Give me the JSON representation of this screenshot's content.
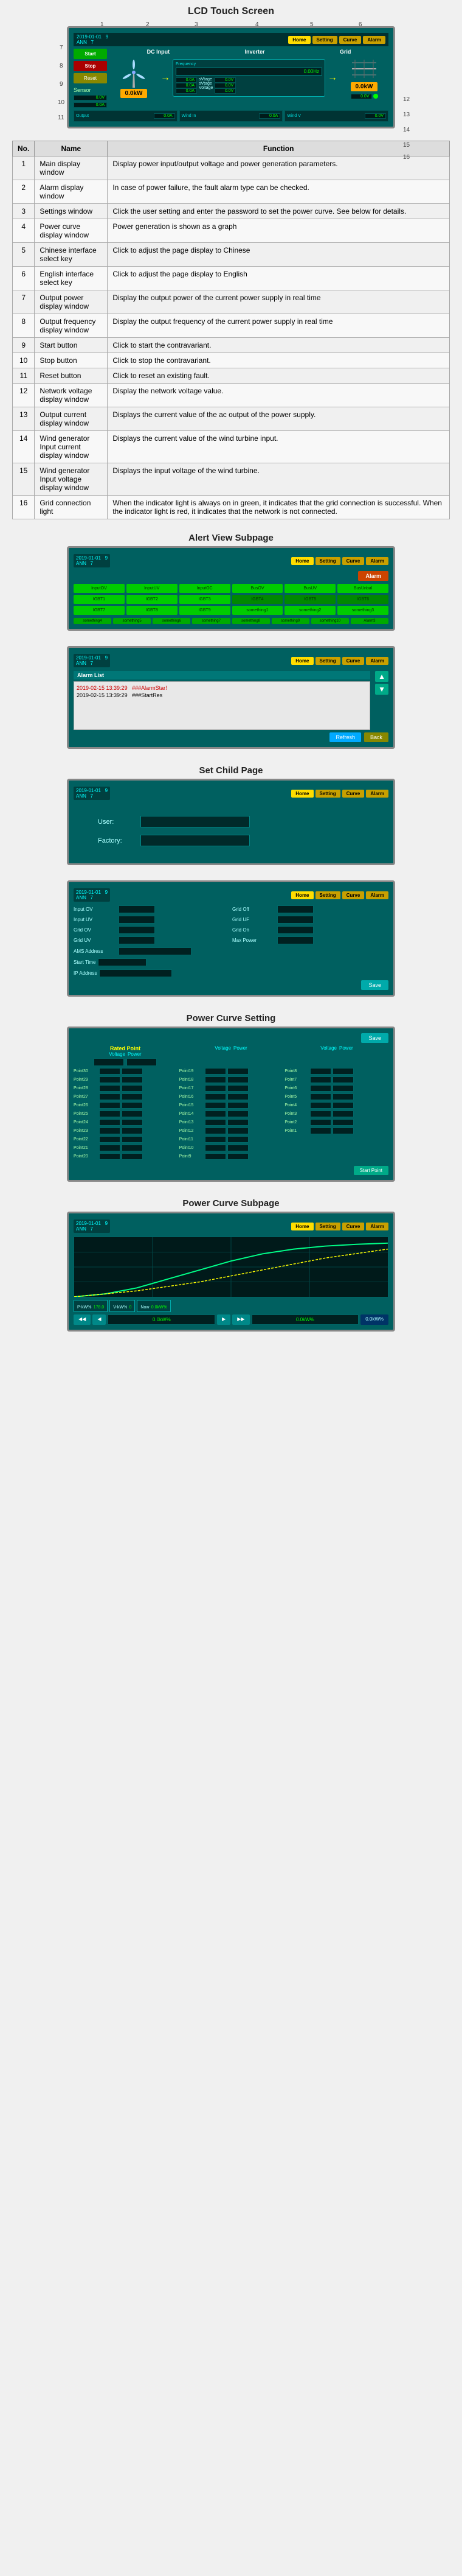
{
  "page": {
    "lcd_screen_title": "LCD Touch Screen",
    "table_section_title": "",
    "alert_subpage_title": "Alert View Subpage",
    "set_child_page_title": "Set Child Page",
    "power_curve_setting_title": "Power Curve Setting",
    "power_curve_subpage_title": "Power Curve Subpage"
  },
  "lcd_diagram": {
    "labels": {
      "dc_input": "DC Input",
      "inverter": "Inverter",
      "grid": "Grid",
      "frequency": "Frequency",
      "power_kw1": "0.0kW",
      "power_kw2": "0.0kW",
      "btn_start": "Start",
      "btn_stop": "Stop",
      "btn_reset": "Reset"
    },
    "values": {
      "current_a1": "0.0A",
      "current_a2": "0.0A",
      "current_a3": "0.0A",
      "voltage_v1": "0.0V",
      "voltage_v2": "0.0V",
      "voltage_v3": "0.0V",
      "voltage_v4": "0.0V"
    },
    "numbers": [
      "1",
      "2",
      "3",
      "4",
      "5",
      "6",
      "7",
      "8",
      "9",
      "10",
      "11",
      "12",
      "13",
      "14",
      "15",
      "16"
    ]
  },
  "table": {
    "headers": [
      "No.",
      "Name",
      "Function"
    ],
    "rows": [
      {
        "no": "1",
        "name": "Main display window",
        "function": "Display power input/output voltage and power generation parameters."
      },
      {
        "no": "2",
        "name": "Alarm display window",
        "function": "In case of power failure, the fault alarm type can be checked."
      },
      {
        "no": "3",
        "name": "Settings window",
        "function": "Click the user setting and enter the password to set the power curve. See below for details."
      },
      {
        "no": "4",
        "name": "Power curve display window",
        "function": "Power generation is shown as a graph"
      },
      {
        "no": "5",
        "name": "Chinese interface select key",
        "function": "Click to adjust the page display to Chinese"
      },
      {
        "no": "6",
        "name": "English interface select key",
        "function": "Click to adjust the page display to English"
      },
      {
        "no": "7",
        "name": "Output power display window",
        "function": "Display the output power of the current power supply in real time"
      },
      {
        "no": "8",
        "name": "Output frequency display window",
        "function": "Display the output frequency of the current power supply in real time"
      },
      {
        "no": "9",
        "name": "Start button",
        "function": "Click to start the contravariant."
      },
      {
        "no": "10",
        "name": "Stop button",
        "function": "Click to stop the contravariant."
      },
      {
        "no": "11",
        "name": "Reset button",
        "function": "Click to reset an existing fault."
      },
      {
        "no": "12",
        "name": "Network voltage display window",
        "function": "Display the network voltage value."
      },
      {
        "no": "13",
        "name": "Output current display window",
        "function": "Displays the current value of the ac output of the power supply."
      },
      {
        "no": "14",
        "name": "Wind generator Input current display window",
        "function": "Displays the current value of the wind turbine input."
      },
      {
        "no": "15",
        "name": "Wind generator Input voltage display window",
        "function": "Displays the input voltage of the wind turbine."
      },
      {
        "no": "16",
        "name": "Grid connection light",
        "function": "When the indicator light is always on in green, it indicates that the grid connection is successful. When the indicator light is red, it indicates that the network is not connected."
      }
    ]
  },
  "nav_tabs": {
    "home": "Home",
    "setting": "Setting",
    "curve": "Curve",
    "alarm": "Alarm"
  },
  "alert_view": {
    "title": "Alert View Subpage",
    "alert_buttons": [
      {
        "label": "InputOV",
        "active": true
      },
      {
        "label": "InputUV",
        "active": true
      },
      {
        "label": "InputOC",
        "active": true
      },
      {
        "label": "BusOV",
        "active": true
      },
      {
        "label": "BusUV",
        "active": true
      },
      {
        "label": "BusUnbal",
        "active": true
      },
      {
        "label": "IGBT1",
        "active": true
      },
      {
        "label": "IGBT2",
        "active": true
      },
      {
        "label": "IGBT3",
        "active": true
      },
      {
        "label": "IGBT4",
        "active": false
      },
      {
        "label": "IGBT5",
        "active": false
      },
      {
        "label": "IGBT6",
        "active": false
      },
      {
        "label": "IGBT7",
        "active": true
      },
      {
        "label": "IGBT8",
        "active": true
      },
      {
        "label": "IGBT9",
        "active": true
      },
      {
        "label": "something1",
        "active": true
      },
      {
        "label": "something2",
        "active": true
      },
      {
        "label": "something3",
        "active": true
      }
    ],
    "bottom_buttons": [
      "something4",
      "something5",
      "something6",
      "something7",
      "something8",
      "something9",
      "something10",
      "Alarm3"
    ]
  },
  "alert_log": {
    "title": "Alert View Subpage",
    "alarm_title": "Alarm List",
    "items": [
      {
        "text": "2019-02-15 13:39:29",
        "type": "alert",
        "detail": "###AlarmStar!"
      },
      {
        "text": "2019-02-15 13:39:29",
        "type": "normal",
        "detail": "###StartRes"
      }
    ],
    "btn_refresh": "Refresh",
    "btn_back": "Back"
  },
  "set_child_page": {
    "title": "Set Child Page",
    "user_label": "User:",
    "user_placeholder": "",
    "factory_label": "Factory:",
    "factory_placeholder": ""
  },
  "settings_page": {
    "fields": [
      {
        "label": "Input OV",
        "value": ""
      },
      {
        "label": "Grid Off",
        "value": ""
      },
      {
        "label": "Input UV",
        "value": ""
      },
      {
        "label": "Grid UF",
        "value": ""
      },
      {
        "label": "Grid OV",
        "value": ""
      },
      {
        "label": "Grid On",
        "value": ""
      },
      {
        "label": "Grid UV",
        "value": ""
      },
      {
        "label": "Max Power",
        "value": ""
      },
      {
        "label": "AMS Address",
        "value": ""
      },
      {
        "label": "Start Time",
        "value": ""
      },
      {
        "label": "IP Address",
        "value": ""
      }
    ],
    "save_btn": "Save"
  },
  "power_curve_setting": {
    "title": "Power Curve Setting",
    "rated_point_label": "Rated Point",
    "voltage_label": "Voltage",
    "power_label": "Power",
    "save_btn": "Save",
    "start_point_btn": "Start Point",
    "points": [
      {
        "label": "Point30",
        "cols": [
          "Point19",
          "Point8"
        ]
      },
      {
        "label": "Point29",
        "cols": [
          "Point18",
          "Point7"
        ]
      },
      {
        "label": "Point28",
        "cols": [
          "Point17",
          "Point6"
        ]
      },
      {
        "label": "Point27",
        "cols": [
          "Point16",
          "Point5"
        ]
      },
      {
        "label": "Point26",
        "cols": [
          "Point15",
          "Point4"
        ]
      },
      {
        "label": "Point25",
        "cols": [
          "Point14",
          "Point3"
        ]
      },
      {
        "label": "Point24",
        "cols": [
          "Point13",
          "Point2"
        ]
      },
      {
        "label": "Point23",
        "cols": [
          "Point12",
          "Point1"
        ]
      },
      {
        "label": "Point22",
        "cols": [
          "Point11",
          ""
        ]
      },
      {
        "label": "Point21",
        "cols": [
          "Point10",
          ""
        ]
      },
      {
        "label": "Point20",
        "cols": [
          "Point9",
          ""
        ]
      }
    ]
  },
  "power_curve_subpage": {
    "title": "Power Curve Subpage",
    "x_labels": [
      "0.0kW%",
      "0.0kW%",
      "0.0kW%"
    ],
    "y_label": "0.0kW%",
    "bottom_values": [
      "0.0kW%",
      "0.0kW%",
      "0.0kW%"
    ]
  }
}
